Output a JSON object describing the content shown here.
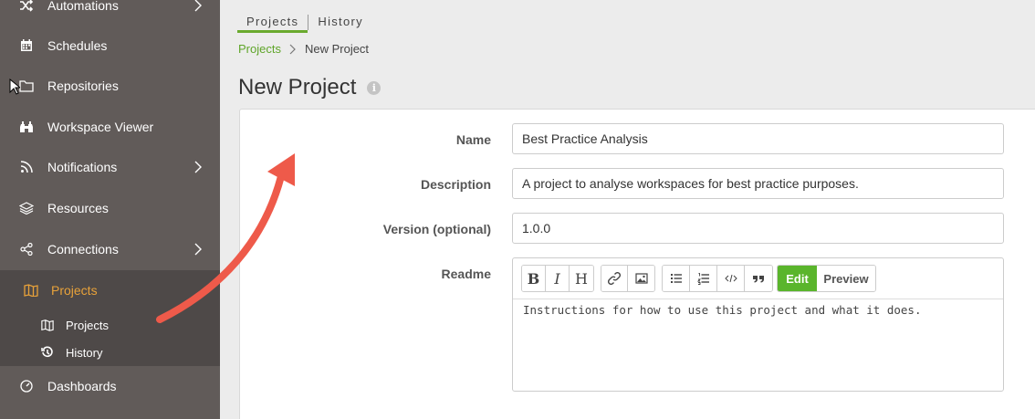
{
  "sidebar": {
    "items": [
      {
        "label": "Automations"
      },
      {
        "label": "Schedules"
      },
      {
        "label": "Repositories"
      },
      {
        "label": "Workspace Viewer"
      },
      {
        "label": "Notifications"
      },
      {
        "label": "Resources"
      },
      {
        "label": "Connections"
      },
      {
        "label": "Projects"
      },
      {
        "label": "Dashboards"
      }
    ],
    "sub_items": [
      {
        "label": "Projects"
      },
      {
        "label": "History"
      }
    ]
  },
  "tabs": [
    {
      "label": "Projects"
    },
    {
      "label": "History"
    }
  ],
  "breadcrumb": {
    "link": "Projects",
    "current": "New Project"
  },
  "page": {
    "title": "New Project"
  },
  "form": {
    "name_label": "Name",
    "name_value": "Best Practice Analysis",
    "description_label": "Description",
    "description_value": "A project to analyse workspaces for best practice purposes.",
    "version_label": "Version (optional)",
    "version_value": "1.0.0",
    "readme_label": "Readme",
    "readme_value": "Instructions for how to use this project and what it does."
  },
  "editor": {
    "bold": "B",
    "italic": "I",
    "heading": "H",
    "edit_label": "Edit",
    "preview_label": "Preview"
  },
  "colors": {
    "sidebar_bg": "#615b59",
    "active_accent": "#e8a23a",
    "green_accent": "#5ab52c",
    "arrow": "#ee5a4a"
  }
}
